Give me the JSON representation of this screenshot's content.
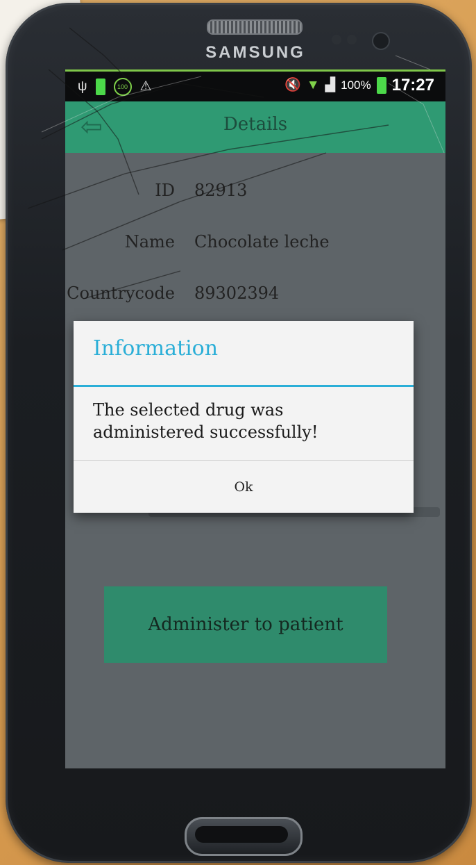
{
  "device": {
    "brand": "SAMSUNG"
  },
  "statusbar": {
    "battery_percent": "100%",
    "time": "17:27",
    "icons_left": [
      "usb-icon",
      "battery-saver-icon",
      "hundred-badge-icon",
      "warning-icon"
    ],
    "icons_right": [
      "mute-icon",
      "wifi-icon",
      "signal-icon",
      "battery-icon"
    ]
  },
  "appbar": {
    "title": "Details"
  },
  "details": {
    "fields": [
      {
        "label": "ID",
        "value": "82913"
      },
      {
        "label": "Name",
        "value": "Chocolate leche"
      },
      {
        "label": "Countrycode",
        "value": "89302394"
      }
    ]
  },
  "main": {
    "administer_label": "Administer to patient"
  },
  "dialog": {
    "title": "Information",
    "message": "The selected drug was administered successfully!",
    "ok_label": "Ok",
    "accent_color": "#2aaed7"
  },
  "colors": {
    "appbar": "#2f9a73",
    "button": "#2f8b6c",
    "statusbar_accent": "#7fc64a"
  }
}
